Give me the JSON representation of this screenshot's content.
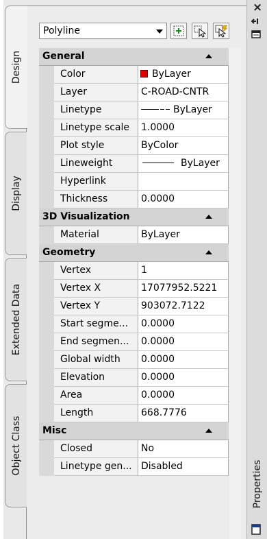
{
  "tabs": {
    "design": "Design",
    "display": "Display",
    "extended_data": "Extended Data",
    "object_class": "Object Class"
  },
  "palette": {
    "window_title": "Properties",
    "close_icon": "×",
    "autohide_icon": "pin-icon",
    "menu_icon": "properties-menu-icon"
  },
  "toolbar": {
    "object_type": "Polyline",
    "buttons": [
      "toggle-pickadd-icon",
      "select-objects-icon",
      "quick-select-icon"
    ]
  },
  "colors": {
    "color_swatch": "#e00000",
    "header_bg": "#d4d4d4"
  },
  "sections": [
    {
      "title": "General",
      "rows": [
        {
          "name": "Color",
          "value": "ByLayer"
        },
        {
          "name": "Layer",
          "value": "C-ROAD-CNTR"
        },
        {
          "name": "Linetype",
          "value": "ByLayer"
        },
        {
          "name": "Linetype scale",
          "value": "1.0000"
        },
        {
          "name": "Plot style",
          "value": "ByColor"
        },
        {
          "name": "Lineweight",
          "value": "ByLayer"
        },
        {
          "name": "Hyperlink",
          "value": ""
        },
        {
          "name": "Thickness",
          "value": "0.0000"
        }
      ]
    },
    {
      "title": "3D Visualization",
      "rows": [
        {
          "name": "Material",
          "value": "ByLayer"
        }
      ]
    },
    {
      "title": "Geometry",
      "rows": [
        {
          "name": "Vertex",
          "value": "1"
        },
        {
          "name": "Vertex X",
          "value": "17077952.5221"
        },
        {
          "name": "Vertex Y",
          "value": "903072.7122"
        },
        {
          "name": "Start segme...",
          "value": "0.0000"
        },
        {
          "name": "End segmen...",
          "value": "0.0000"
        },
        {
          "name": "Global width",
          "value": "0.0000"
        },
        {
          "name": "Elevation",
          "value": "0.0000"
        },
        {
          "name": "Area",
          "value": "0.0000"
        },
        {
          "name": "Length",
          "value": "668.7776"
        }
      ]
    },
    {
      "title": "Misc",
      "rows": [
        {
          "name": "Closed",
          "value": "No"
        },
        {
          "name": "Linetype gen...",
          "value": "Disabled"
        }
      ]
    }
  ]
}
